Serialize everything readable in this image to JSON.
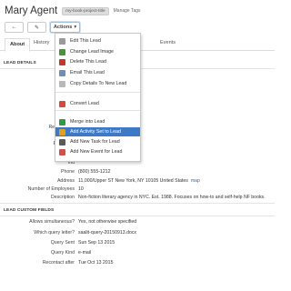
{
  "header": {
    "title": "Mary Agent",
    "tag": "my-book-project-title",
    "manage_tags": "Manage Tags"
  },
  "toolbar": {
    "back_glyph": "←",
    "edit_glyph": "✎",
    "actions_label": "Actions",
    "caret": "▾"
  },
  "tabs": [
    "About",
    "History",
    "Events"
  ],
  "actions_menu": {
    "groups": [
      [
        {
          "label": "Edit This Lead",
          "icon": "edit-icon",
          "color": "#9a9a9a"
        },
        {
          "label": "Change Lead Image",
          "icon": "image-icon",
          "color": "#4c8f3e"
        },
        {
          "label": "Delete This Lead",
          "icon": "delete-icon",
          "color": "#c0392b"
        },
        {
          "label": "Email This Lead",
          "icon": "email-icon",
          "color": "#6b8fb8"
        },
        {
          "label": "Copy Details To New Lead",
          "icon": "copy-icon",
          "color": "#b8b8b8"
        }
      ],
      [
        {
          "label": "Convert Lead",
          "icon": "convert-icon",
          "color": "#d64a3a"
        }
      ],
      [
        {
          "label": "Merge into Lead",
          "icon": "merge-icon",
          "color": "#2f9a4a"
        },
        {
          "label": "Add Activity Set to Lead",
          "icon": "activity-icon",
          "color": "#e0a020",
          "highlighted": true
        },
        {
          "label": "Add New Task for Lead",
          "icon": "task-icon",
          "color": "#5a5a5a"
        },
        {
          "label": "Add New Event for Lead",
          "icon": "event-icon",
          "color": "#d05050"
        }
      ]
    ]
  },
  "lead_details": {
    "heading": "LEAD DETAILS",
    "fields": [
      {
        "label": "Lead N",
        "value": ""
      },
      {
        "label": "Organiz",
        "value": "y Agency"
      },
      {
        "label": "Lead St",
        "value": ""
      },
      {
        "label": "Lead So",
        "value": ""
      },
      {
        "label": "Responsible",
        "value": ""
      },
      {
        "label": "Lead Ra",
        "value": ""
      },
      {
        "label": "Email Add",
        "value": "moliterary.com",
        "link": true
      },
      {
        "label": "We",
        "value": "com",
        "link": true
      },
      {
        "label": "Ind",
        "value": ""
      },
      {
        "label": "Phone",
        "value": "(800) 555-1212"
      },
      {
        "label": "Address",
        "value": "11,000/Upper ST New York, NY 10105 United States",
        "extra": "map"
      },
      {
        "label": "Number of Employees",
        "value": "10"
      },
      {
        "label": "Description",
        "value": "Non-fiction literary agency in NYC. Est. 1988. Focuses on how-to and self-help NF books."
      }
    ]
  },
  "custom_fields": {
    "heading": "LEAD CUSTOM FIELDS",
    "fields": [
      {
        "label": "Allows simultaneous?",
        "value": "Yes, not otherwise specified"
      },
      {
        "label": "Which query letter?",
        "value": "saalit-query-20150913.docx"
      },
      {
        "label": "Query Sent",
        "value": "Sun Sep 13 2015"
      },
      {
        "label": "Query Kind",
        "value": "e-mail"
      },
      {
        "label": "Recontact after",
        "value": "Tue Oct 13 2015"
      }
    ]
  }
}
